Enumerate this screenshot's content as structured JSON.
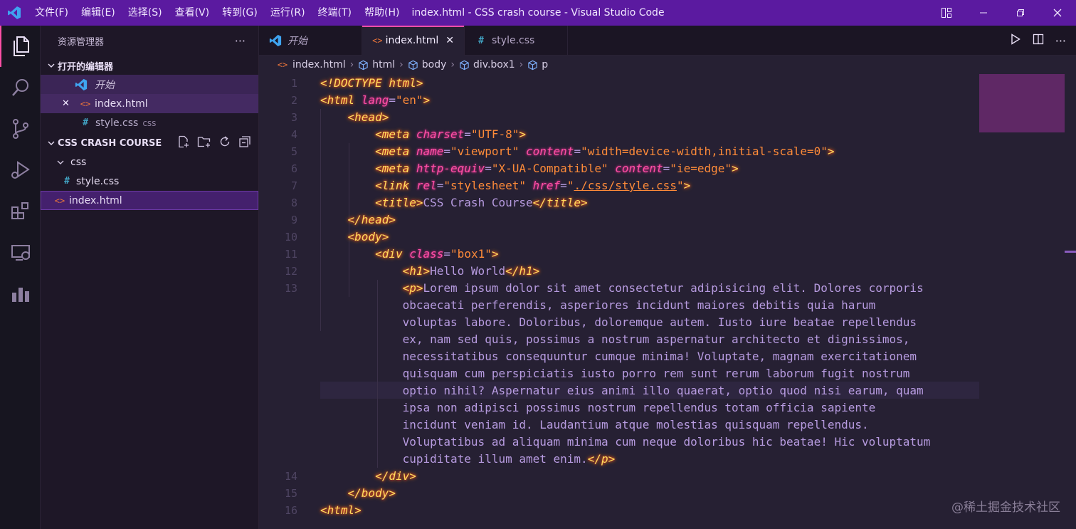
{
  "titlebar": {
    "window_title": "index.html - CSS crash course - Visual Studio Code",
    "menu": [
      "文件(F)",
      "编辑(E)",
      "选择(S)",
      "查看(V)",
      "转到(G)",
      "运行(R)",
      "终端(T)",
      "帮助(H)"
    ]
  },
  "activitybar": {
    "icons": [
      "explorer-icon",
      "search-icon",
      "source-control-icon",
      "run-debug-icon",
      "extensions-icon",
      "remote-explorer-icon",
      "analytics-icon"
    ]
  },
  "sidebar": {
    "header": "资源管理器",
    "more": "···",
    "open_editors": {
      "title": "打开的编辑器",
      "items": [
        {
          "label": "开始",
          "italic": true
        },
        {
          "label": "index.html",
          "close": "✕"
        },
        {
          "label": "style.css",
          "hint": "css"
        }
      ]
    },
    "project": {
      "title": "CSS CRASH COURSE",
      "folder": "css",
      "folder_file": "style.css",
      "root_file": "index.html"
    }
  },
  "tabs": [
    {
      "label": "开始"
    },
    {
      "label": "index.html",
      "close": "✕"
    },
    {
      "label": "style.css"
    }
  ],
  "breadcrumb": [
    "index.html",
    "html",
    "body",
    "div.box1",
    "p"
  ],
  "editor": {
    "line_numbers": [
      "1",
      "2",
      "3",
      "4",
      "5",
      "6",
      "7",
      "8",
      "9",
      "10",
      "11",
      "12",
      "13",
      "14",
      "15",
      "16"
    ],
    "lines": [
      [
        {
          "c": "tg",
          "t": "<!DOCTYPE html>"
        }
      ],
      [
        {
          "c": "tg",
          "t": "<html "
        },
        {
          "c": "at",
          "t": "lang"
        },
        {
          "c": "tx",
          "t": "="
        },
        {
          "c": "st",
          "t": "\"en\""
        },
        {
          "c": "tg",
          "t": ">"
        }
      ],
      [
        {
          "c": "tg",
          "t": "    <head>"
        }
      ],
      [
        {
          "c": "tg",
          "t": "        <meta "
        },
        {
          "c": "at",
          "t": "charset"
        },
        {
          "c": "tx",
          "t": "="
        },
        {
          "c": "st",
          "t": "\"UTF-8\""
        },
        {
          "c": "tg",
          "t": ">"
        }
      ],
      [
        {
          "c": "tg",
          "t": "        <meta "
        },
        {
          "c": "at",
          "t": "name"
        },
        {
          "c": "tx",
          "t": "="
        },
        {
          "c": "st",
          "t": "\"viewport\" "
        },
        {
          "c": "at",
          "t": "content"
        },
        {
          "c": "tx",
          "t": "="
        },
        {
          "c": "st",
          "t": "\"width=device-width,initial-scale=0\""
        },
        {
          "c": "tg",
          "t": ">"
        }
      ],
      [
        {
          "c": "tg",
          "t": "        <meta "
        },
        {
          "c": "at",
          "t": "http-equiv"
        },
        {
          "c": "tx",
          "t": "="
        },
        {
          "c": "st",
          "t": "\"X-UA-Compatible\" "
        },
        {
          "c": "at",
          "t": "content"
        },
        {
          "c": "tx",
          "t": "="
        },
        {
          "c": "st",
          "t": "\"ie=edge\""
        },
        {
          "c": "tg",
          "t": ">"
        }
      ],
      [
        {
          "c": "tg",
          "t": "        <link "
        },
        {
          "c": "at",
          "t": "rel"
        },
        {
          "c": "tx",
          "t": "="
        },
        {
          "c": "st",
          "t": "\"stylesheet\" "
        },
        {
          "c": "at",
          "t": "href"
        },
        {
          "c": "tx",
          "t": "="
        },
        {
          "c": "st",
          "t": "\""
        },
        {
          "c": "st ul",
          "t": "./css/style.css"
        },
        {
          "c": "st",
          "t": "\""
        },
        {
          "c": "tg",
          "t": ">"
        }
      ],
      [
        {
          "c": "tg",
          "t": "        <title>"
        },
        {
          "c": "tx",
          "t": "CSS Crash Course"
        },
        {
          "c": "tg",
          "t": "</title>"
        }
      ],
      [
        {
          "c": "tg",
          "t": "    </head>"
        }
      ],
      [
        {
          "c": "tg",
          "t": "    <body>"
        }
      ],
      [
        {
          "c": "tg",
          "t": "        <div "
        },
        {
          "c": "at",
          "t": "class"
        },
        {
          "c": "tx",
          "t": "="
        },
        {
          "c": "st",
          "t": "\"box1\""
        },
        {
          "c": "tg",
          "t": ">"
        }
      ],
      [
        {
          "c": "tg",
          "t": "            <h1>"
        },
        {
          "c": "tx",
          "t": "Hello World"
        },
        {
          "c": "tg",
          "t": "</h1>"
        }
      ],
      [
        {
          "c": "tg",
          "t": "            <p>"
        },
        {
          "c": "tx",
          "t": "Lorem ipsum dolor sit amet consectetur adipisicing elit. Dolores corporis"
        }
      ],
      [
        {
          "c": "tx",
          "t": "            obcaecati perferendis, asperiores incidunt maiores debitis quia harum"
        }
      ],
      [
        {
          "c": "tx",
          "t": "            voluptas labore. Doloribus, doloremque autem. Iusto iure beatae repellendus"
        }
      ],
      [
        {
          "c": "tx",
          "t": "            ex, nam sed quis, possimus a nostrum aspernatur architecto et dignissimos,"
        }
      ],
      [
        {
          "c": "tx",
          "t": "            necessitatibus consequuntur cumque minima! Voluptate, magnam exercitationem"
        }
      ],
      [
        {
          "c": "tx",
          "t": "            quisquam cum perspiciatis iusto porro rem sunt rerum laborum fugit nostrum"
        }
      ],
      [
        {
          "c": "tx",
          "t": "            optio nihil? Aspernatur eius animi illo quaerat, optio quod nisi earum, quam"
        }
      ],
      [
        {
          "c": "tx",
          "t": "            ipsa non adipisci possimus nostrum repellendus totam officia sapiente"
        }
      ],
      [
        {
          "c": "tx",
          "t": "            incidunt veniam id. Laudantium atque molestias quisquam repellendus."
        }
      ],
      [
        {
          "c": "tx",
          "t": "            Voluptatibus ad aliquam minima cum neque doloribus hic beatae! Hic voluptatum"
        }
      ],
      [
        {
          "c": "tx",
          "t": "            cupiditate illum amet enim."
        },
        {
          "c": "tg",
          "t": "</p>"
        }
      ],
      [
        {
          "c": "tg",
          "t": "        </div>"
        }
      ],
      [
        {
          "c": "tg",
          "t": "    </body>"
        }
      ],
      [
        {
          "c": "tg",
          "t": "<html>"
        }
      ]
    ]
  },
  "watermark": "@稀土掘金技术社区",
  "colors": {
    "titlebar": "#5b1aa0",
    "accent": "#ff4fa6",
    "tag": "#fede5d",
    "attribute": "#ff4fa6",
    "string": "#ff8b39",
    "text": "#b79be0"
  }
}
